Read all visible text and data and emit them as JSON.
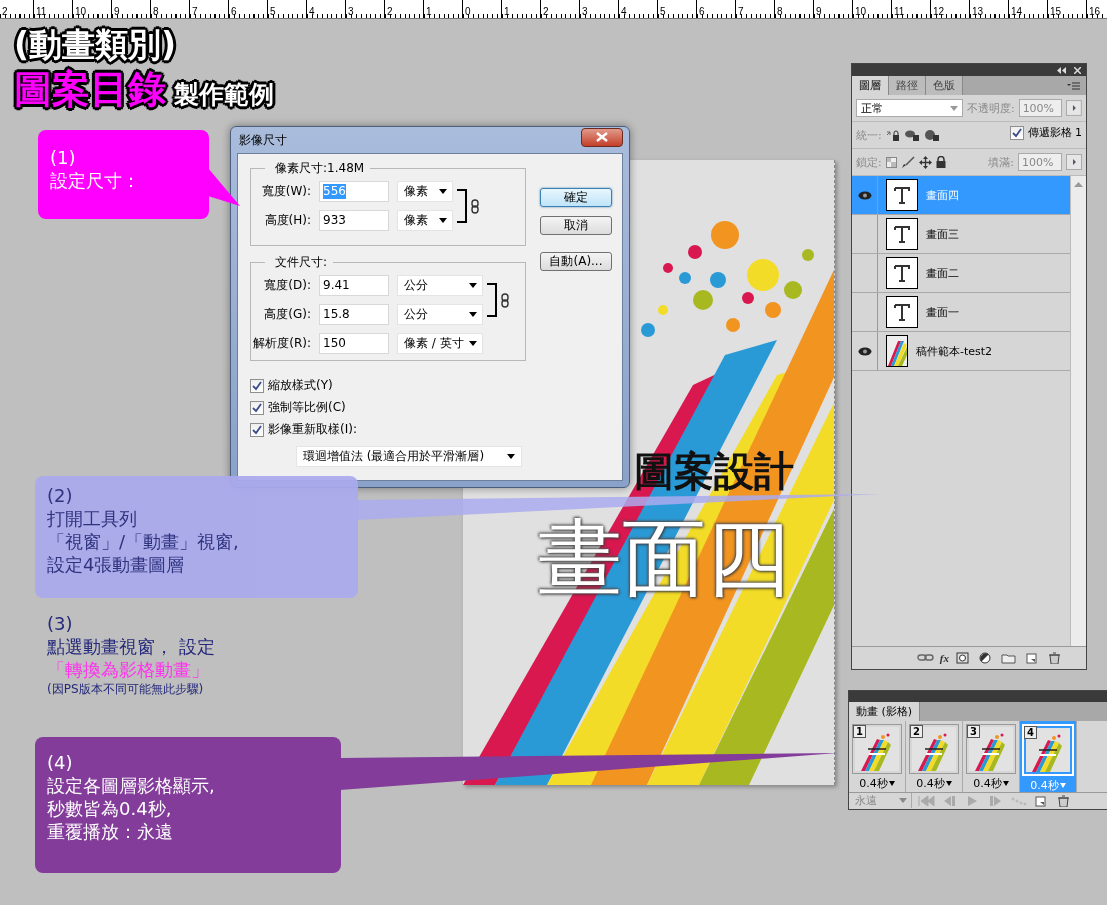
{
  "ruler": {
    "labels": [
      "2",
      "11",
      "10",
      "9",
      "8",
      "7",
      "6",
      "5",
      "4",
      "3",
      "2",
      "1",
      "0",
      "1",
      "2",
      "3",
      "4",
      "5",
      "6",
      "7",
      "8",
      "9",
      "10",
      "11",
      "12",
      "13",
      "14",
      "15",
      "16"
    ]
  },
  "heading": {
    "category": "(動畫類別)",
    "topic": "圖案目錄",
    "suffix": "製作範例"
  },
  "callouts": [
    {
      "kind": "bubble",
      "color": "#ff00ff",
      "lines": [
        {
          "kind": "plain",
          "text": "(1)"
        },
        {
          "kind": "plain",
          "text": "設定尺寸："
        }
      ]
    },
    {
      "kind": "bubble",
      "color": "#aaaaee",
      "lines": [
        {
          "kind": "plain",
          "text": "(2)"
        },
        {
          "kind": "plain",
          "text": "打開工具列"
        },
        {
          "kind": "plain",
          "text": "「視窗」/「動畫」視窗,"
        },
        {
          "kind": "plain",
          "text": "設定4張動畫圖層"
        }
      ]
    },
    {
      "kind": "plain",
      "lines": [
        {
          "kind": "plain",
          "text": "(3)"
        },
        {
          "kind": "plain",
          "text": "點選動畫視窗， 設定"
        },
        {
          "kind": "accent",
          "text": "「轉換為影格動畫」"
        },
        {
          "kind": "note",
          "text": "(因PS版本不同可能無此步驟)"
        }
      ]
    },
    {
      "kind": "bubble",
      "color": "#833c99",
      "lines": [
        {
          "kind": "plain",
          "text": "(4)"
        },
        {
          "kind": "plain",
          "text": "設定各圖層影格顯示,"
        },
        {
          "kind": "plain",
          "text": "秒數皆為0.4秒,"
        },
        {
          "kind": "plain",
          "text": "重覆播放：永遠"
        }
      ]
    }
  ],
  "dialog": {
    "title": "影像尺寸",
    "groups": [
      {
        "legend": "像素尺寸:1.48M",
        "linked_fields": [
          {
            "label": "寬度(W):",
            "value": "556",
            "selected": true,
            "unit": "像素"
          },
          {
            "label": "高度(H):",
            "value": "933",
            "selected": false,
            "unit": "像素"
          }
        ]
      },
      {
        "legend": "文件尺寸:",
        "linked_fields": [
          {
            "label": "寬度(D):",
            "value": "9.41",
            "selected": false,
            "unit": "公分"
          },
          {
            "label": "高度(G):",
            "value": "15.8",
            "selected": false,
            "unit": "公分"
          }
        ],
        "fields": [
          {
            "label": "解析度(R):",
            "value": "150",
            "selected": false,
            "unit": "像素 / 英寸"
          }
        ]
      }
    ],
    "checkboxes": [
      {
        "label": "縮放樣式(Y)",
        "checked": true
      },
      {
        "label": "強制等比例(C)",
        "checked": true
      },
      {
        "label": "影像重新取樣(I):",
        "checked": true
      }
    ],
    "resample": "環迴增值法 (最適合用於平滑漸層)",
    "buttons": [
      {
        "label": "確定",
        "default": true
      },
      {
        "label": "取消",
        "default": false
      },
      {
        "label": "自動(A)...",
        "default": false
      }
    ]
  },
  "poster": {
    "headline": "圖案設計",
    "overlay": "畫面四"
  },
  "layers_panel": {
    "tabs": [
      {
        "label": "圖層",
        "selected": true
      },
      {
        "label": "路徑",
        "selected": false
      },
      {
        "label": "色版",
        "selected": false
      }
    ],
    "blend_mode": "正常",
    "opacity_label": "不透明度:",
    "opacity": "100%",
    "unify_label": "統一:",
    "propagate": {
      "label": "傳遞影格 1",
      "checked": true
    },
    "lock_label": "鎖定:",
    "style_button": "fx",
    "fill_label": "填滿:",
    "fill": "100%",
    "layers": [
      {
        "kind": "text",
        "name": "畫面四",
        "visible": true,
        "selected": true
      },
      {
        "kind": "text",
        "name": "畫面三",
        "visible": false,
        "selected": false
      },
      {
        "kind": "text",
        "name": "畫面二",
        "visible": false,
        "selected": false
      },
      {
        "kind": "text",
        "name": "畫面一",
        "visible": false,
        "selected": false
      },
      {
        "kind": "image",
        "name": "稿件範本-test2",
        "visible": true,
        "selected": false
      }
    ]
  },
  "animation_panel": {
    "tab": "動畫 (影格)",
    "frames": [
      {
        "number": "1",
        "delay": "0.4秒",
        "selected": false
      },
      {
        "number": "2",
        "delay": "0.4秒",
        "selected": false
      },
      {
        "number": "3",
        "delay": "0.4秒",
        "selected": false
      },
      {
        "number": "4",
        "delay": "0.4秒",
        "selected": true
      }
    ],
    "loop": "永遠"
  }
}
